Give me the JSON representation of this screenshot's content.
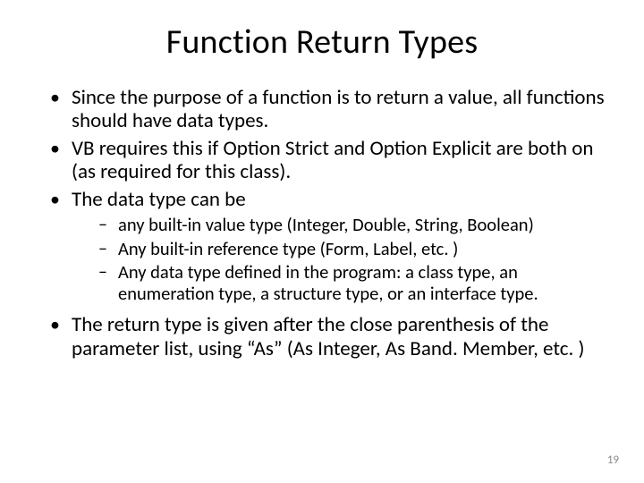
{
  "title": "Function Return Types",
  "bullets": {
    "b1": "Since the purpose of a function is to return a value, all functions should have data types.",
    "b2": "VB requires this if Option Strict and Option Explicit are both on (as required for this class).",
    "b3": "The data type can be",
    "s1": "any built-in value type (Integer, Double, String, Boolean)",
    "s2": "Any built-in reference type (Form, Label, etc. )",
    "s3": "Any data type defined in the program: a class type, an enumeration type, a structure type, or an interface type.",
    "b4": "The return type is given after the close parenthesis of the parameter list, using “As” (As Integer, As Band. Member, etc. )"
  },
  "page_number": "19"
}
